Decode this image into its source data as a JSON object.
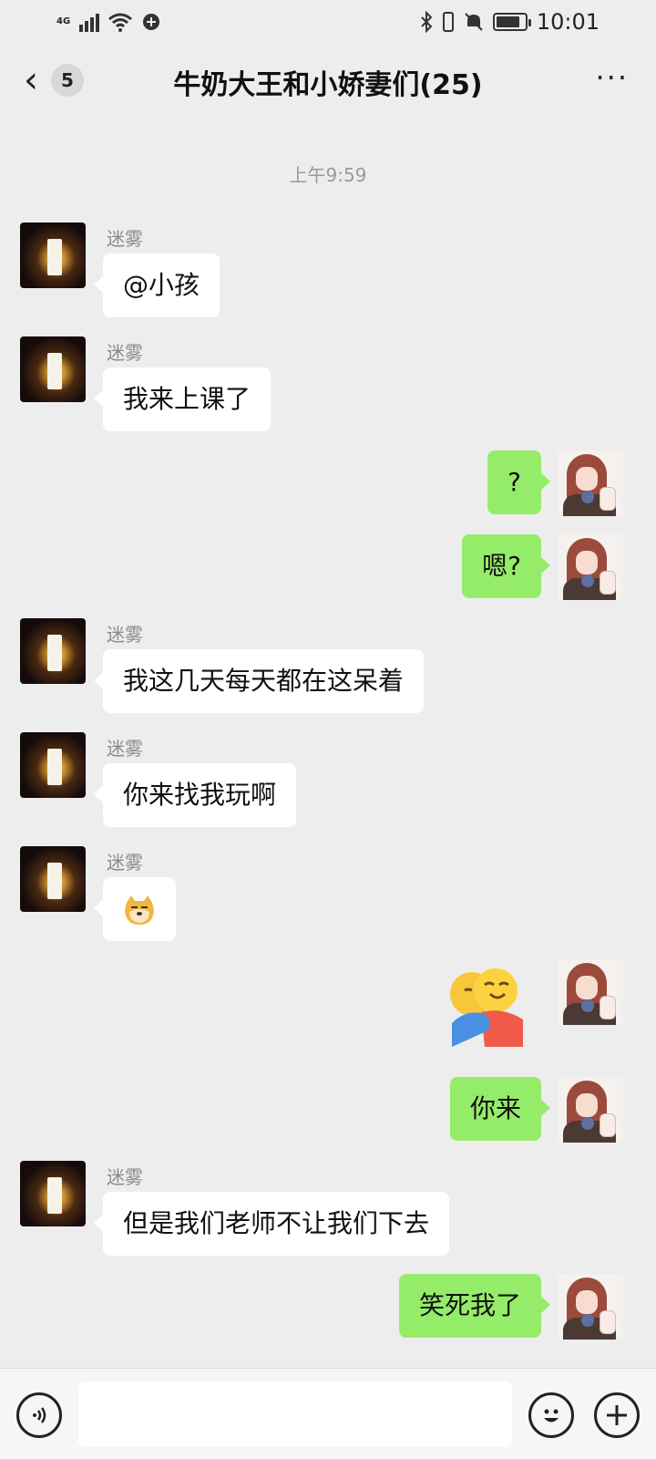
{
  "status_bar": {
    "network": "4G",
    "time": "10:01",
    "icons": [
      "signal-icon",
      "wifi-icon",
      "vpn-icon",
      "bluetooth-icon",
      "vibrate-icon",
      "mute-icon",
      "battery-icon"
    ]
  },
  "header": {
    "back_icon": "chevron-left-icon",
    "unread_count": "5",
    "title": "牛奶大王和小娇妻们(25)",
    "more_icon": "more-dots-icon"
  },
  "chat": {
    "timestamp": "上午9:59",
    "messages": [
      {
        "side": "left",
        "sender": "迷雾",
        "text": "@小孩"
      },
      {
        "side": "left",
        "sender": "迷雾",
        "text": "我来上课了"
      },
      {
        "side": "right",
        "text": "?"
      },
      {
        "side": "right",
        "text": "嗯?"
      },
      {
        "side": "left",
        "sender": "迷雾",
        "text": "我这几天每天都在这呆着"
      },
      {
        "side": "left",
        "sender": "迷雾",
        "text": "你来找我玩啊"
      },
      {
        "side": "left",
        "sender": "迷雾",
        "sticker": "doge-emoji"
      },
      {
        "side": "right",
        "sticker": "hug-emoji"
      },
      {
        "side": "right",
        "text": "你来"
      },
      {
        "side": "left",
        "sender": "迷雾",
        "text": "但是我们老师不让我们下去"
      },
      {
        "side": "right",
        "text": "笑死我了"
      }
    ]
  },
  "input_bar": {
    "voice_icon": "voice-icon",
    "emoji_icon": "emoji-icon",
    "plus_icon": "plus-icon",
    "input_value": ""
  },
  "colors": {
    "background": "#ededed",
    "own_bubble": "#95ec69",
    "other_bubble": "#ffffff"
  }
}
